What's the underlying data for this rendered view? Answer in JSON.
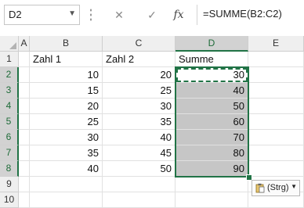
{
  "name_box": {
    "value": "D2"
  },
  "formula_bar": {
    "cancel_glyph": "✕",
    "enter_glyph": "✓",
    "fx_glyph": "fx",
    "value": "=SUMME(B2:C2)"
  },
  "columns": [
    "A",
    "B",
    "C",
    "D",
    "E"
  ],
  "rows": [
    "1",
    "2",
    "3",
    "4",
    "5",
    "6",
    "7",
    "8",
    "9",
    "10"
  ],
  "sheet": {
    "header_row": {
      "B": "Zahl 1",
      "C": "Zahl 2",
      "D": "Summe"
    },
    "data": [
      {
        "B": "10",
        "C": "20",
        "D": "30"
      },
      {
        "B": "15",
        "C": "25",
        "D": "40"
      },
      {
        "B": "20",
        "C": "30",
        "D": "50"
      },
      {
        "B": "25",
        "C": "35",
        "D": "60"
      },
      {
        "B": "30",
        "C": "40",
        "D": "70"
      },
      {
        "B": "35",
        "C": "45",
        "D": "80"
      },
      {
        "B": "40",
        "C": "50",
        "D": "90"
      }
    ]
  },
  "paste_options": {
    "label": "(Strg)",
    "icon": "clipboard-icon"
  },
  "colors": {
    "accent": "#217346",
    "selection_fill": "#c6c6c6"
  }
}
